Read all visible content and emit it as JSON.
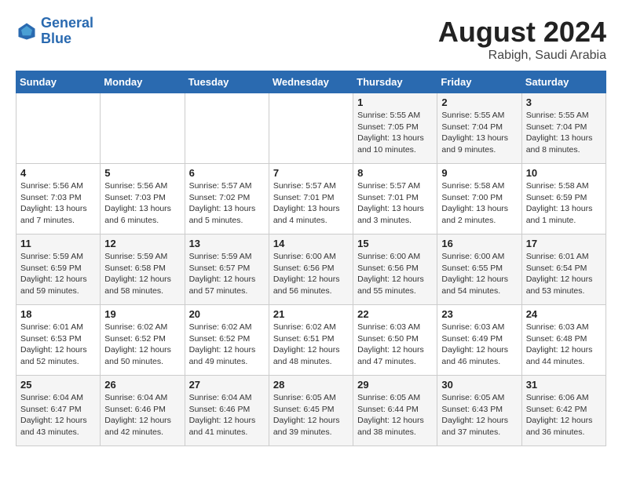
{
  "logo": {
    "name1": "General",
    "name2": "Blue"
  },
  "title": "August 2024",
  "subtitle": "Rabigh, Saudi Arabia",
  "days_of_week": [
    "Sunday",
    "Monday",
    "Tuesday",
    "Wednesday",
    "Thursday",
    "Friday",
    "Saturday"
  ],
  "weeks": [
    [
      {
        "date": "",
        "info": ""
      },
      {
        "date": "",
        "info": ""
      },
      {
        "date": "",
        "info": ""
      },
      {
        "date": "",
        "info": ""
      },
      {
        "date": "1",
        "info": "Sunrise: 5:55 AM\nSunset: 7:05 PM\nDaylight: 13 hours\nand 10 minutes."
      },
      {
        "date": "2",
        "info": "Sunrise: 5:55 AM\nSunset: 7:04 PM\nDaylight: 13 hours\nand 9 minutes."
      },
      {
        "date": "3",
        "info": "Sunrise: 5:55 AM\nSunset: 7:04 PM\nDaylight: 13 hours\nand 8 minutes."
      }
    ],
    [
      {
        "date": "4",
        "info": "Sunrise: 5:56 AM\nSunset: 7:03 PM\nDaylight: 13 hours\nand 7 minutes."
      },
      {
        "date": "5",
        "info": "Sunrise: 5:56 AM\nSunset: 7:03 PM\nDaylight: 13 hours\nand 6 minutes."
      },
      {
        "date": "6",
        "info": "Sunrise: 5:57 AM\nSunset: 7:02 PM\nDaylight: 13 hours\nand 5 minutes."
      },
      {
        "date": "7",
        "info": "Sunrise: 5:57 AM\nSunset: 7:01 PM\nDaylight: 13 hours\nand 4 minutes."
      },
      {
        "date": "8",
        "info": "Sunrise: 5:57 AM\nSunset: 7:01 PM\nDaylight: 13 hours\nand 3 minutes."
      },
      {
        "date": "9",
        "info": "Sunrise: 5:58 AM\nSunset: 7:00 PM\nDaylight: 13 hours\nand 2 minutes."
      },
      {
        "date": "10",
        "info": "Sunrise: 5:58 AM\nSunset: 6:59 PM\nDaylight: 13 hours\nand 1 minute."
      }
    ],
    [
      {
        "date": "11",
        "info": "Sunrise: 5:59 AM\nSunset: 6:59 PM\nDaylight: 12 hours\nand 59 minutes."
      },
      {
        "date": "12",
        "info": "Sunrise: 5:59 AM\nSunset: 6:58 PM\nDaylight: 12 hours\nand 58 minutes."
      },
      {
        "date": "13",
        "info": "Sunrise: 5:59 AM\nSunset: 6:57 PM\nDaylight: 12 hours\nand 57 minutes."
      },
      {
        "date": "14",
        "info": "Sunrise: 6:00 AM\nSunset: 6:56 PM\nDaylight: 12 hours\nand 56 minutes."
      },
      {
        "date": "15",
        "info": "Sunrise: 6:00 AM\nSunset: 6:56 PM\nDaylight: 12 hours\nand 55 minutes."
      },
      {
        "date": "16",
        "info": "Sunrise: 6:00 AM\nSunset: 6:55 PM\nDaylight: 12 hours\nand 54 minutes."
      },
      {
        "date": "17",
        "info": "Sunrise: 6:01 AM\nSunset: 6:54 PM\nDaylight: 12 hours\nand 53 minutes."
      }
    ],
    [
      {
        "date": "18",
        "info": "Sunrise: 6:01 AM\nSunset: 6:53 PM\nDaylight: 12 hours\nand 52 minutes."
      },
      {
        "date": "19",
        "info": "Sunrise: 6:02 AM\nSunset: 6:52 PM\nDaylight: 12 hours\nand 50 minutes."
      },
      {
        "date": "20",
        "info": "Sunrise: 6:02 AM\nSunset: 6:52 PM\nDaylight: 12 hours\nand 49 minutes."
      },
      {
        "date": "21",
        "info": "Sunrise: 6:02 AM\nSunset: 6:51 PM\nDaylight: 12 hours\nand 48 minutes."
      },
      {
        "date": "22",
        "info": "Sunrise: 6:03 AM\nSunset: 6:50 PM\nDaylight: 12 hours\nand 47 minutes."
      },
      {
        "date": "23",
        "info": "Sunrise: 6:03 AM\nSunset: 6:49 PM\nDaylight: 12 hours\nand 46 minutes."
      },
      {
        "date": "24",
        "info": "Sunrise: 6:03 AM\nSunset: 6:48 PM\nDaylight: 12 hours\nand 44 minutes."
      }
    ],
    [
      {
        "date": "25",
        "info": "Sunrise: 6:04 AM\nSunset: 6:47 PM\nDaylight: 12 hours\nand 43 minutes."
      },
      {
        "date": "26",
        "info": "Sunrise: 6:04 AM\nSunset: 6:46 PM\nDaylight: 12 hours\nand 42 minutes."
      },
      {
        "date": "27",
        "info": "Sunrise: 6:04 AM\nSunset: 6:46 PM\nDaylight: 12 hours\nand 41 minutes."
      },
      {
        "date": "28",
        "info": "Sunrise: 6:05 AM\nSunset: 6:45 PM\nDaylight: 12 hours\nand 39 minutes."
      },
      {
        "date": "29",
        "info": "Sunrise: 6:05 AM\nSunset: 6:44 PM\nDaylight: 12 hours\nand 38 minutes."
      },
      {
        "date": "30",
        "info": "Sunrise: 6:05 AM\nSunset: 6:43 PM\nDaylight: 12 hours\nand 37 minutes."
      },
      {
        "date": "31",
        "info": "Sunrise: 6:06 AM\nSunset: 6:42 PM\nDaylight: 12 hours\nand 36 minutes."
      }
    ]
  ]
}
